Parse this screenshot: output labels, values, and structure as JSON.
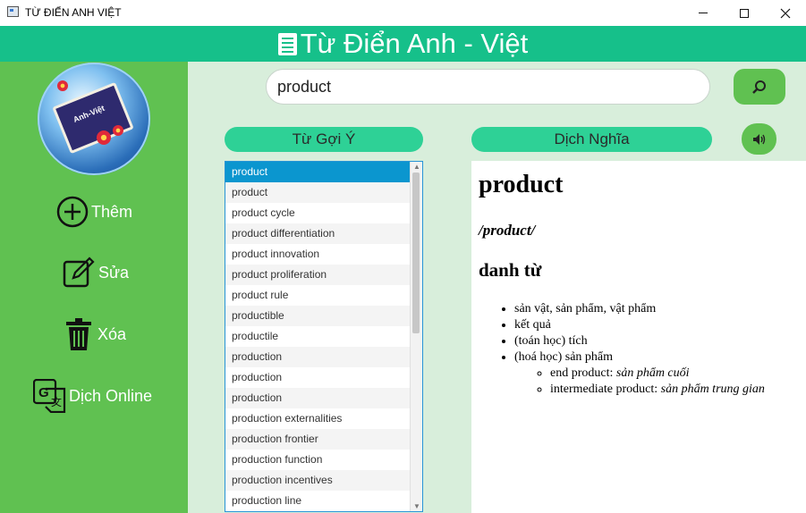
{
  "window": {
    "title": "TỪ ĐIỂN ANH VIỆT",
    "buttons": {
      "minimize": "–",
      "maximize": "□",
      "close": "✕"
    }
  },
  "header": {
    "title": "Từ Điển Anh - Việt",
    "icon": "book-list-icon"
  },
  "sidebar": {
    "logo": {
      "label": "Anh-Việt",
      "icon": "dictionary-globe-logo"
    },
    "items": [
      {
        "label": "Thêm",
        "icon": "plus-circle-icon"
      },
      {
        "label": "Sửa",
        "icon": "edit-icon"
      },
      {
        "label": "Xóa",
        "icon": "trash-icon"
      },
      {
        "label": "Dịch Online",
        "icon": "google-translate-icon"
      }
    ]
  },
  "search": {
    "value": "product",
    "button_icon": "search-icon"
  },
  "suggest": {
    "label": "Từ Gợi Ý",
    "items": [
      "product",
      "product",
      "product cycle",
      "product differentiation",
      "product innovation",
      "product proliferation",
      "product rule",
      "productible",
      "productile",
      "production",
      "production",
      "production",
      "production externalities",
      "production frontier",
      "production function",
      "production incentives",
      "production line"
    ],
    "selected_index": 0
  },
  "translate": {
    "label": "Dịch Nghĩa",
    "speaker_icon": "speaker-icon"
  },
  "definition": {
    "word": "product",
    "phonetic": "/product/",
    "part_of_speech": "danh từ",
    "meanings": [
      "sản vật, sản phẩm, vật phẩm",
      "kết quả",
      "(toán học) tích",
      "(hoá học) sản phẩm"
    ],
    "examples": [
      {
        "en": "end product:",
        "vi": "sản phẩm cuối"
      },
      {
        "en": "intermediate product:",
        "vi": "sản phẩm trung gian"
      }
    ]
  },
  "colors": {
    "header": "#16c08a",
    "sidebar": "#60c151",
    "main_bg": "#d8eedb",
    "pill": "#2ed196",
    "selection": "#0b96cf"
  }
}
